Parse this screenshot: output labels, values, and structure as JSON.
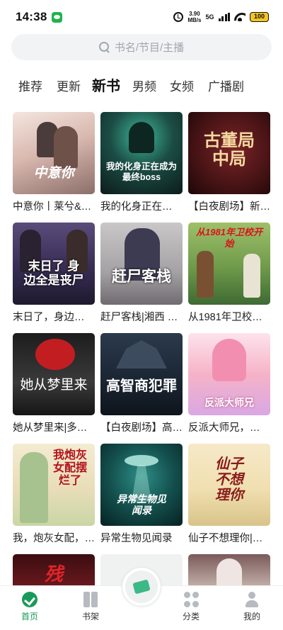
{
  "status": {
    "time": "14:38",
    "net_speed_value": "3.90",
    "net_speed_unit": "MB/s",
    "network": "5G",
    "battery": "100"
  },
  "search": {
    "placeholder": "书名/节目/主播"
  },
  "tabs": [
    {
      "label": "推荐",
      "active": false
    },
    {
      "label": "更新",
      "active": false
    },
    {
      "label": "新书",
      "active": true
    },
    {
      "label": "男频",
      "active": false
    },
    {
      "label": "女频",
      "active": false
    },
    {
      "label": "广播剧",
      "active": false
    }
  ],
  "books": [
    {
      "title": "中意你丨莱兮&…",
      "cover_text": "中意你"
    },
    {
      "title": "我的化身正在…",
      "cover_text": "我的化身正在成为最终boss"
    },
    {
      "title": "【白夜剧场】新…",
      "cover_text": "古董局中局"
    },
    {
      "title": "末日了，身边…",
      "cover_text": "末日了 身边全是丧尸"
    },
    {
      "title": "赶尸客栈|湘西 …",
      "cover_text": "赶尸客栈"
    },
    {
      "title": "从1981年卫校…",
      "cover_text": "从1981年卫校开始"
    },
    {
      "title": "她从梦里来|多…",
      "cover_text": "她从梦里来"
    },
    {
      "title": "【白夜剧场】高…",
      "cover_text": "高智商犯罪"
    },
    {
      "title": "反派大师兄，…",
      "cover_text": "反派大师兄"
    },
    {
      "title": "我，炮灰女配，…",
      "cover_text": "我炮灰女配摆烂了"
    },
    {
      "title": "异常生物见闻录",
      "cover_text": "异常生物见闻录"
    },
    {
      "title": "仙子不想理你|…",
      "cover_text": "仙子不想理你"
    },
    {
      "title": "",
      "cover_text": "残"
    },
    {
      "title": "",
      "cover_text": ""
    },
    {
      "title": "",
      "cover_text": ""
    }
  ],
  "bottom_nav": {
    "home": "首页",
    "shelf": "书架",
    "category": "分类",
    "mine": "我的"
  },
  "colors": {
    "accent": "#1a9a5a",
    "inactive_icon": "#b7bac0"
  }
}
